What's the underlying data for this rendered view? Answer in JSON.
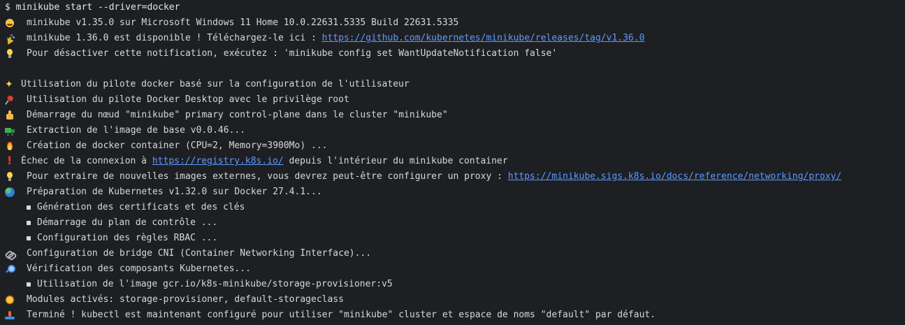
{
  "terminal": {
    "command": "$ minikube start --driver=docker",
    "lines": [
      {
        "icon": "smiling-face-icon",
        "text": "minikube v1.35.0 sur Microsoft Windows 11 Home 10.0.22631.5335 Build 22631.5335"
      },
      {
        "icon": "party-popper-icon",
        "text": "minikube 1.36.0 est disponible ! Téléchargez-le ici : ",
        "link": "https://github.com/kubernetes/minikube/releases/tag/v1.36.0"
      },
      {
        "icon": "light-bulb-icon",
        "text": "Pour désactiver cette notification, exécutez : 'minikube config set WantUpdateNotification false'"
      },
      {
        "icon": "sparkles-icon",
        "text": "Utilisation du pilote docker basé sur la configuration de l'utilisateur"
      },
      {
        "icon": "pushpin-icon",
        "text": "Utilisation du pilote Docker Desktop avec le privilège root"
      },
      {
        "icon": "thumbs-up-icon",
        "text": "Démarrage du nœud \"minikube\" primary control-plane dans le cluster \"minikube\""
      },
      {
        "icon": "tractor-icon",
        "text": "Extraction de l'image de base v0.0.46..."
      },
      {
        "icon": "fire-icon",
        "text": "Création de docker container (CPU=2, Memory=3900Mo) ..."
      },
      {
        "icon": "exclamation-icon",
        "text_before": "Échec de la connexion à ",
        "link": "https://registry.k8s.io/",
        "text_after": " depuis l'intérieur du minikube container"
      },
      {
        "icon": "light-bulb-icon",
        "text": "Pour extraire de nouvelles images externes, vous devrez peut-être configurer un proxy : ",
        "link": "https://minikube.sigs.k8s.io/docs/reference/networking/proxy/"
      },
      {
        "icon": "globe-icon",
        "text": "Préparation de Kubernetes v1.32.0 sur Docker 27.4.1..."
      },
      {
        "bullet": true,
        "text": "Génération des certificats et des clés"
      },
      {
        "bullet": true,
        "text": "Démarrage du plan de contrôle ..."
      },
      {
        "bullet": true,
        "text": "Configuration des règles RBAC ..."
      },
      {
        "icon": "link-icon",
        "text": "Configuration de bridge CNI (Container Networking Interface)..."
      },
      {
        "icon": "magnifier-icon",
        "text": "Vérification des composants Kubernetes..."
      },
      {
        "bullet": true,
        "text": "Utilisation de l'image gcr.io/k8s-minikube/storage-provisioner:v5"
      },
      {
        "icon": "sun-icon",
        "text": "Modules activés: storage-provisioner, default-storageclass"
      },
      {
        "icon": "surfer-icon",
        "text": "Terminé ! kubectl est maintenant configuré pour utiliser \"minikube\" cluster et espace de noms \"default\" par défaut."
      }
    ]
  },
  "colors": {
    "background": "#1e1f22",
    "text": "#d6d8dc",
    "link": "#5c9bff"
  }
}
